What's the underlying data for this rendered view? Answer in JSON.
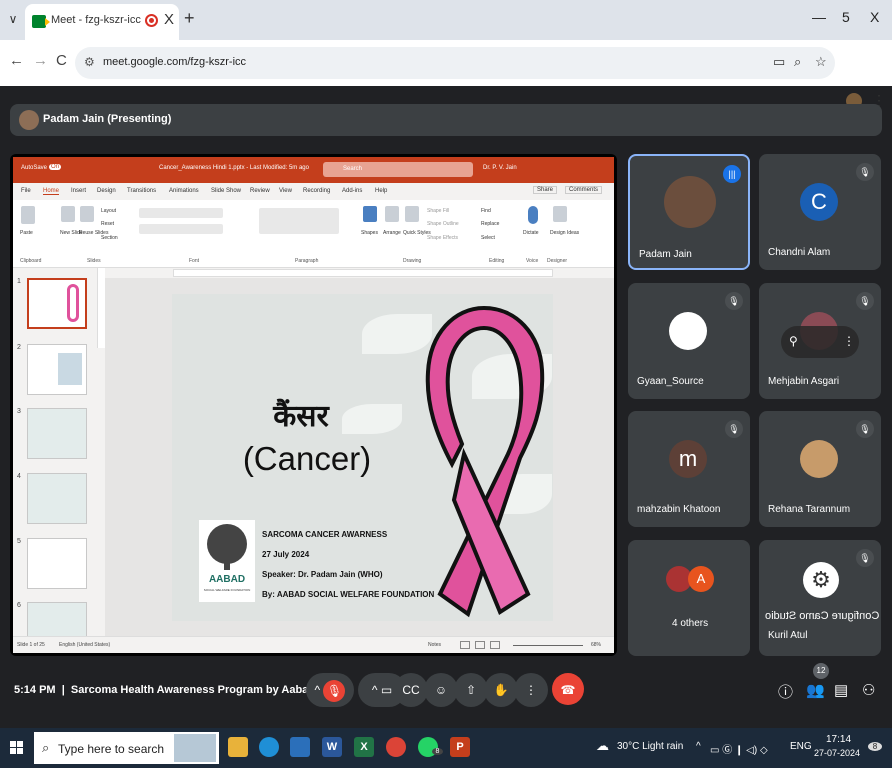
{
  "browser": {
    "tab_title": "Meet - fzg-kszr-icc",
    "tab_close": "X",
    "new_tab": "+",
    "tab_menu": "∨",
    "minimize": "—",
    "restore": "5",
    "close": "X",
    "back": "←",
    "forward": "→",
    "reload": "C",
    "url": "meet.google.com/fzg-kszr-icc",
    "menu": "⋮"
  },
  "meet": {
    "presenter_banner": "Padam Jain (Presenting)",
    "time": "5:14 PM",
    "meeting_title": "Sarcoma Health Awareness Program by Aabad So...",
    "participant_count": "12",
    "participants": [
      {
        "name": "Padam Jain",
        "initial": "",
        "color": "#6b4e3d"
      },
      {
        "name": "Chandni Alam",
        "initial": "C",
        "color": "#1a5fb4"
      },
      {
        "name": "Gyaan_Source",
        "initial": "",
        "color": "#ffffff"
      },
      {
        "name": "Mehjabin Asgari",
        "initial": "",
        "color": "#8a4b55"
      },
      {
        "name": "mahzabin Khatoon",
        "initial": "m",
        "color": "#5d4037"
      },
      {
        "name": "Rehana Tarannum",
        "initial": "",
        "color": "#c79b6a"
      },
      {
        "name": "4 others",
        "initial": "A",
        "color": "#e8541e"
      },
      {
        "name": "Kuril Atul",
        "initial": "",
        "color": "#ffffff",
        "overlay": "Configure Camo Studio"
      }
    ]
  },
  "ppt": {
    "autosave": "AutoSave",
    "toggle": "On",
    "file_title": "Cancer_Awareness Hindi 1.pptx - Last Modified: 5m ago",
    "search": "Search",
    "user": "Dr. P. V. Jain",
    "tabs": [
      "File",
      "Home",
      "Insert",
      "Design",
      "Transitions",
      "Animations",
      "Slide Show",
      "Review",
      "View",
      "Recording",
      "Add-ins",
      "Help"
    ],
    "share": "Share",
    "comments": "Comments",
    "groups": [
      "Clipboard",
      "Slides",
      "Font",
      "Paragraph",
      "Drawing",
      "Editing",
      "Voice",
      "Designer"
    ],
    "ribbon_labels": [
      "Paste",
      "New Slide",
      "Reuse Slides",
      "Layout",
      "Reset",
      "Section",
      "Shapes",
      "Arrange",
      "Quick Styles",
      "Shape Fill",
      "Shape Outline",
      "Shape Effects",
      "Find",
      "Replace",
      "Select",
      "Dictate",
      "Design Ideas"
    ],
    "slide_numbers": [
      "1",
      "2",
      "3",
      "4",
      "5",
      "6"
    ],
    "slide": {
      "title_hindi": "कैंसर",
      "title_english": "(Cancer)",
      "logo_name": "AABAD",
      "logo_sub": "SOCIAL WELFARE FOUNDATION",
      "line1": "SARCOMA CANCER AWARNESS",
      "line2": "27 July 2024",
      "line3": "Speaker: Dr. Padam Jain (WHO)",
      "line4": "By: AABAD SOCIAL WELFARE FOUNDATION"
    },
    "status_slide": "Slide 1 of 25",
    "status_lang": "English (United States)",
    "notes": "Notes",
    "zoom": "68%"
  },
  "taskbar": {
    "search_placeholder": "Type here to search",
    "weather": "30°C Light rain",
    "lang": "ENG",
    "time": "17:14",
    "date": "27-07-2024",
    "whatsapp_badge": "8",
    "notif_badge": "8"
  },
  "colors": {
    "ppt_accent": "#c43e1c",
    "meet_bg": "#202124",
    "tile_bg": "#3c4043",
    "end_call": "#ea4335",
    "ribbon_pink": "#e0529c"
  }
}
